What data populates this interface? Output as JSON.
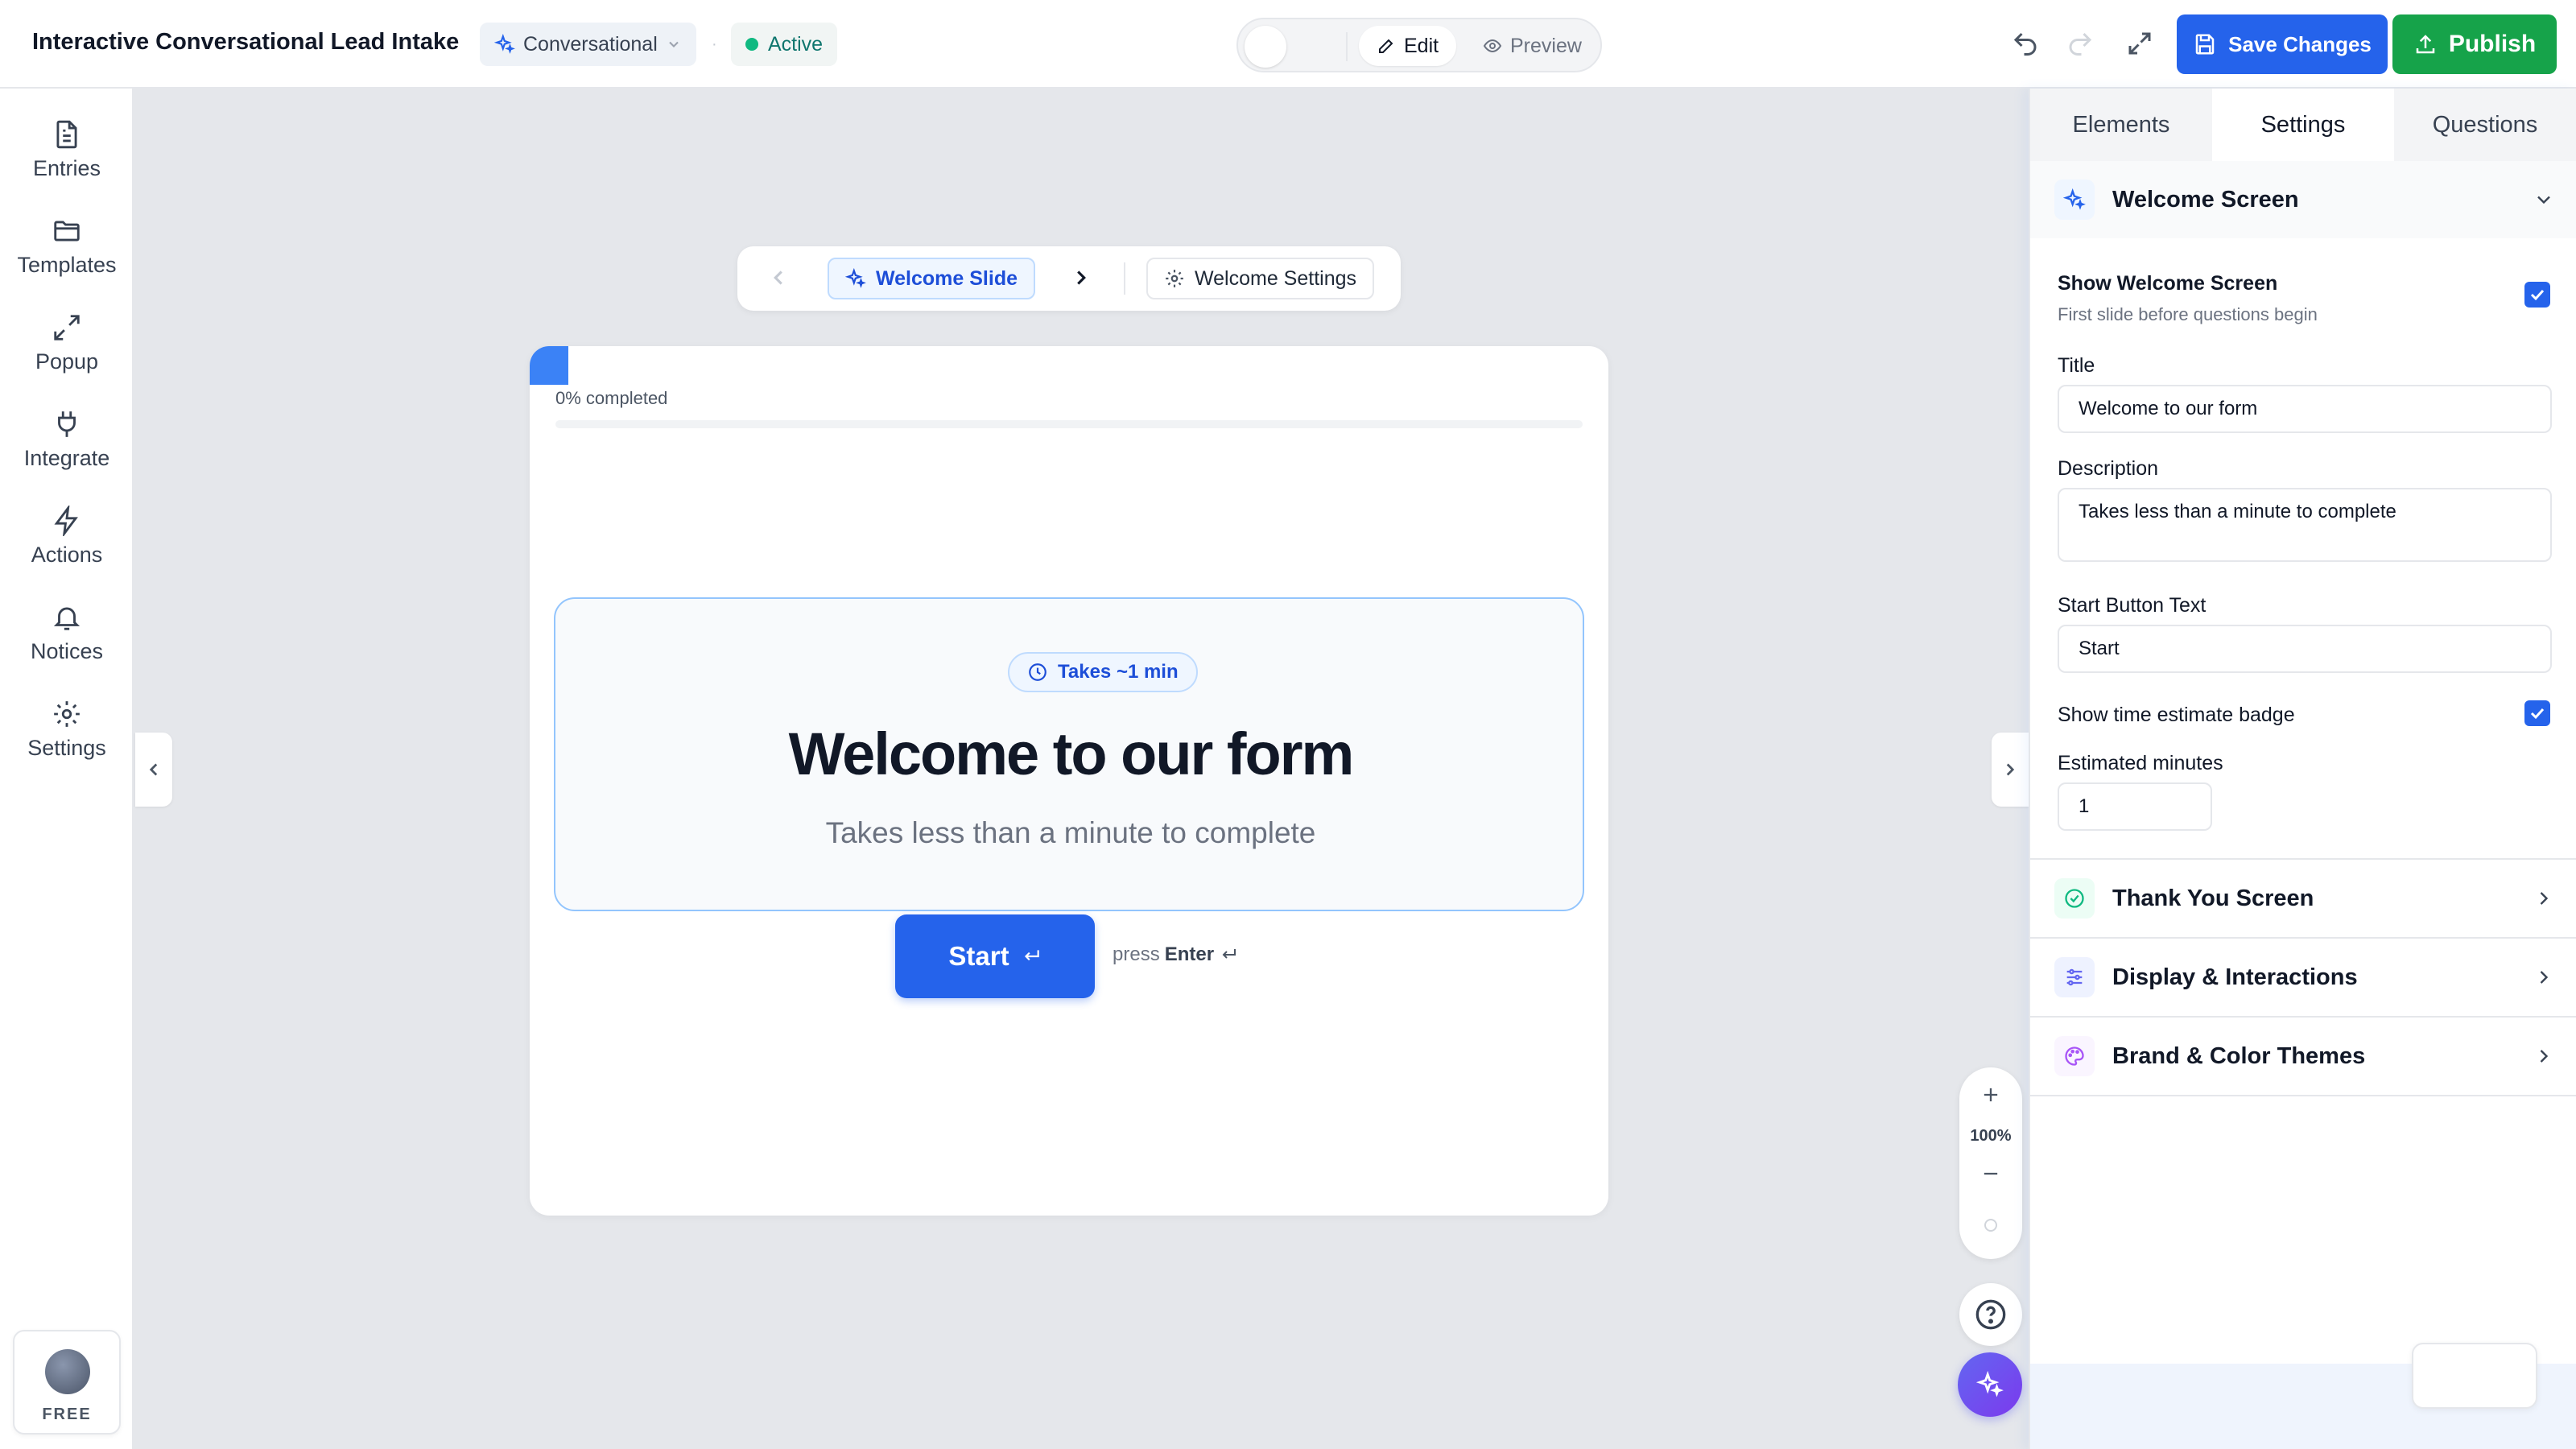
{
  "topbar": {
    "title": "Interactive Conversational Lead Intake",
    "mode_label": "Conversational",
    "status_label": "Active",
    "toggle": {
      "edit_label": "Edit",
      "preview_label": "Preview"
    },
    "save_label": "Save Changes",
    "publish_label": "Publish"
  },
  "sidebar": {
    "items": [
      {
        "label": "Entries",
        "icon": "document-icon"
      },
      {
        "label": "Templates",
        "icon": "folder-icon"
      },
      {
        "label": "Popup",
        "icon": "expand-icon"
      },
      {
        "label": "Integrate",
        "icon": "plug-icon"
      },
      {
        "label": "Actions",
        "icon": "bolt-icon"
      },
      {
        "label": "Notices",
        "icon": "bell-icon"
      },
      {
        "label": "Settings",
        "icon": "gear-icon"
      }
    ],
    "plan_label": "FREE"
  },
  "slide_nav": {
    "current_slide": "Welcome Slide",
    "settings_label": "Welcome Settings"
  },
  "form": {
    "progress_text": "0% completed",
    "progress_value": 0,
    "badge": "Takes ~1 min",
    "title": "Welcome to our form",
    "description": "Takes less than a minute to complete",
    "start_button": "Start",
    "hint_prefix": "press",
    "hint_key": "Enter"
  },
  "zoom": {
    "level": "100%"
  },
  "right_panel": {
    "tabs": [
      "Elements",
      "Settings",
      "Questions"
    ],
    "active_tab": "Settings",
    "welcome_section": {
      "title": "Welcome Screen",
      "show_label": "Show Welcome Screen",
      "show_sub": "First slide before questions begin",
      "show_checked": true,
      "title_label": "Title",
      "title_value": "Welcome to our form",
      "description_label": "Description",
      "description_value": "Takes less than a minute to complete",
      "start_text_label": "Start Button Text",
      "start_text_value": "Start",
      "time_badge_label": "Show time estimate badge",
      "time_badge_checked": true,
      "minutes_label": "Estimated minutes",
      "minutes_value": "1"
    },
    "collapsed_sections": [
      {
        "title": "Thank You Screen",
        "icon": "check-circle-icon",
        "color": "#10b981"
      },
      {
        "title": "Display & Interactions",
        "icon": "sliders-icon",
        "color": "#6366f1"
      },
      {
        "title": "Brand & Color Themes",
        "icon": "palette-icon",
        "color": "#a855f7"
      }
    ]
  },
  "colors": {
    "primary": "#2563eb",
    "publish": "#16a34a",
    "active": "#10b981",
    "canvas_bg": "#e5e7eb"
  }
}
